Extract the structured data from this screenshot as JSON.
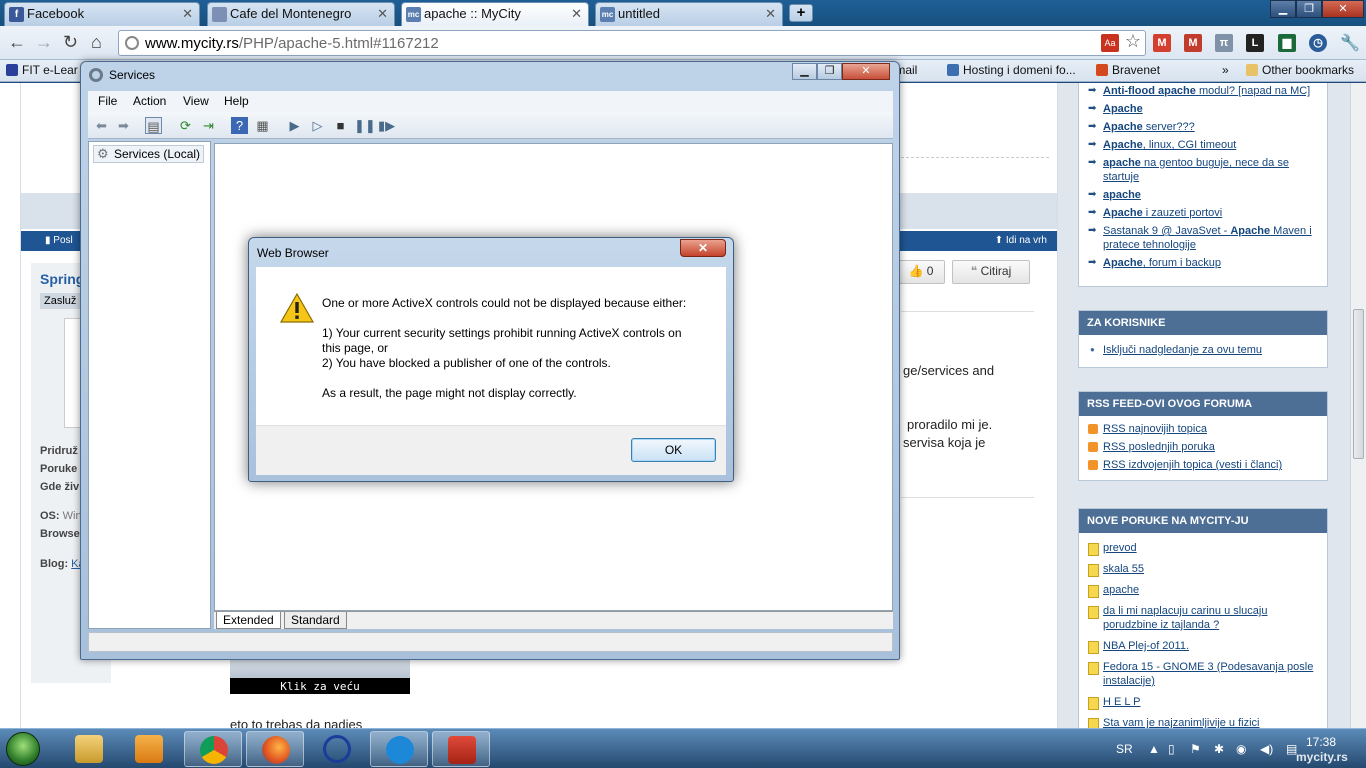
{
  "browser": {
    "tabs": [
      {
        "title": "Facebook",
        "favicon": "facebook-icon",
        "color": "#3b5998",
        "glyph": "f"
      },
      {
        "title": "Cafe del Montenegro",
        "favicon": "page-icon",
        "color": "#7d8fb5",
        "glyph": ""
      },
      {
        "title": "apache :: MyCity",
        "favicon": "mycity-icon",
        "color": "#5a7fb0",
        "glyph": "mc"
      },
      {
        "title": "untitled",
        "favicon": "mycity-icon",
        "color": "#5a7fb0",
        "glyph": "mc"
      }
    ],
    "url_domain": "www.mycity.rs",
    "url_path": "/PHP/apache-5.html#1167212",
    "bookmarks_left": "FIT e-Lear",
    "bookmarks_right": [
      {
        "label": "Gmail",
        "icon": "gmail-icon"
      },
      {
        "label": "Hosting i domeni fo...",
        "icon": "hosting-icon"
      },
      {
        "label": "Bravenet",
        "icon": "bravenet-icon"
      },
      {
        "label": "»",
        "icon": ""
      },
      {
        "label": "Other bookmarks",
        "icon": "folder-icon"
      }
    ]
  },
  "page": {
    "post_bar_left": "Posl",
    "post_bar_right": "Idi na vrh",
    "user_name": "Spring",
    "user_title": "Zasluž",
    "user_info": [
      "Pridruž",
      "Poruke",
      "Gde živ"
    ],
    "os_label": "OS:",
    "os_value": "Win",
    "browser_label": "Browse",
    "blog_label": "Blog:",
    "blog_value": "Ka",
    "like_count": "0",
    "quote_label": "Citiraj",
    "text_lines": [
      "ge/services and",
      "proradilo mi je.",
      "servisa koja je"
    ],
    "thumb_caption": "Klik za veću",
    "bottom_text": "eto to trebas da nadjes"
  },
  "sidebar": {
    "related": [
      {
        "bold": "Anti-flood apache",
        "rest": " modul? [napad na MC]",
        "pre": ""
      },
      {
        "bold": "Apache",
        "rest": "",
        "pre": ""
      },
      {
        "bold": "Apache",
        "rest": " server???",
        "pre": ""
      },
      {
        "bold": "Apache",
        "rest": ", linux, CGI timeout",
        "pre": ""
      },
      {
        "bold": "apache",
        "rest": " na gentoo buguje, nece da se startuje",
        "pre": ""
      },
      {
        "bold": "apache",
        "rest": "",
        "pre": ""
      },
      {
        "bold": "Apache",
        "rest": " i zauzeti portovi",
        "pre": ""
      },
      {
        "bold": "Apache",
        "rest": " Maven i pratece tehnologije",
        "pre": "Sastanak 9 @ JavaSvet - "
      },
      {
        "bold": "Apache",
        "rest": ", forum i backup",
        "pre": ""
      }
    ],
    "za_korisnike_title": "ZA KORISNIKE",
    "za_korisnike": [
      "Isključi nadgledanje za ovu temu"
    ],
    "rss_title": "RSS FEED-OVI OVOG FORUMA",
    "rss": [
      "RSS najnovijih topica",
      "RSS poslednjih poruka",
      "RSS izdvojenjih topica (vesti i članci)"
    ],
    "nove_title": "NOVE PORUKE NA MYCITY-JU",
    "nove": [
      "prevod",
      "skala 55",
      "apache",
      "da li mi naplacuju carinu u slucaju porudzbine iz tajlanda ?",
      "NBA Plej-of 2011.",
      "Fedora 15 - GNOME 3 (Podesavanja posle instalacije)",
      "H E L P",
      "Sta vam je najzanimljivije u fizici"
    ]
  },
  "services": {
    "title": "Services",
    "menus": [
      "File",
      "Action",
      "View",
      "Help"
    ],
    "tree_node": "Services (Local)",
    "tab_extended": "Extended",
    "tab_standard": "Standard"
  },
  "dialog": {
    "title": "Web Browser",
    "line1": "One or more ActiveX controls could not be displayed because either:",
    "line2": "1) Your current security settings prohibit running ActiveX controls on",
    "line3": "this page, or",
    "line4": "2) You have blocked a publisher of one of the controls.",
    "line5": "As a result, the page might not display correctly.",
    "ok": "OK"
  },
  "taskbar": {
    "language": "SR",
    "time": "17:38",
    "watermark": "mycity.rs",
    "apps": [
      "explorer",
      "media-player",
      "chrome",
      "firefox",
      "opera",
      "telenor",
      "toolbox"
    ]
  }
}
